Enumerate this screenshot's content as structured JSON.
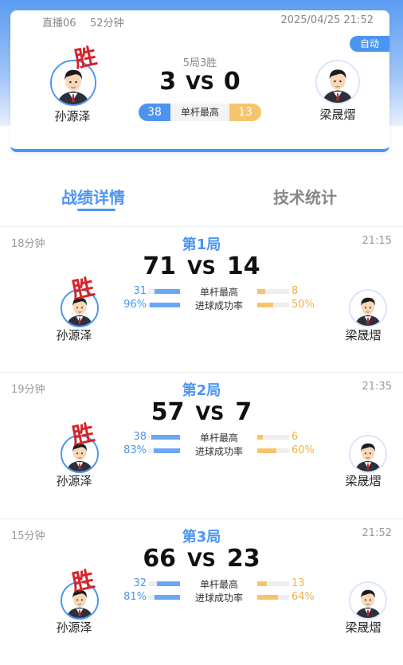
{
  "summary": {
    "room": "直播06",
    "duration": "52分钟",
    "datetime": "2025/04/25 21:52",
    "auto_badge": "自动",
    "format": "5局3胜",
    "score_left": "3",
    "vs": "VS",
    "score_right": "0",
    "stat_label": "单杆最高",
    "stat_left": "38",
    "stat_right": "13",
    "player_left": "孙源泽",
    "player_right": "梁晟熠",
    "win_stamp": "胜"
  },
  "tabs": {
    "details": "战绩详情",
    "stats": "技术统计"
  },
  "colors": {
    "accent": "#4b95f2",
    "gold": "#f6c56b",
    "win_red": "#d6232b"
  },
  "games": [
    {
      "duration": "18分钟",
      "title": "第1局",
      "time": "21:15",
      "score_left": "71",
      "vs": "VS",
      "score_right": "14",
      "player_left": "孙源泽",
      "player_right": "梁晟熠",
      "win_stamp": "胜",
      "stats": [
        {
          "label": "单杆最高",
          "left": "31",
          "right": "8",
          "left_ratio": 0.8,
          "right_ratio": 0.25
        },
        {
          "label": "进球成功率",
          "left": "96%",
          "right": "50%",
          "left_ratio": 0.96,
          "right_ratio": 0.5
        }
      ]
    },
    {
      "duration": "19分钟",
      "title": "第2局",
      "time": "21:35",
      "score_left": "57",
      "vs": "VS",
      "score_right": "7",
      "player_left": "孙源泽",
      "player_right": "梁晟熠",
      "win_stamp": "胜",
      "stats": [
        {
          "label": "单杆最高",
          "left": "38",
          "right": "6",
          "left_ratio": 0.9,
          "right_ratio": 0.18
        },
        {
          "label": "进球成功率",
          "left": "83%",
          "right": "60%",
          "left_ratio": 0.83,
          "right_ratio": 0.6
        }
      ]
    },
    {
      "duration": "15分钟",
      "title": "第3局",
      "time": "21:52",
      "score_left": "66",
      "vs": "VS",
      "score_right": "23",
      "player_left": "孙源泽",
      "player_right": "梁晟熠",
      "win_stamp": "胜",
      "stats": [
        {
          "label": "单杆最高",
          "left": "32",
          "right": "13",
          "left_ratio": 0.72,
          "right_ratio": 0.3
        },
        {
          "label": "进球成功率",
          "left": "81%",
          "right": "64%",
          "left_ratio": 0.81,
          "right_ratio": 0.64
        }
      ]
    }
  ]
}
